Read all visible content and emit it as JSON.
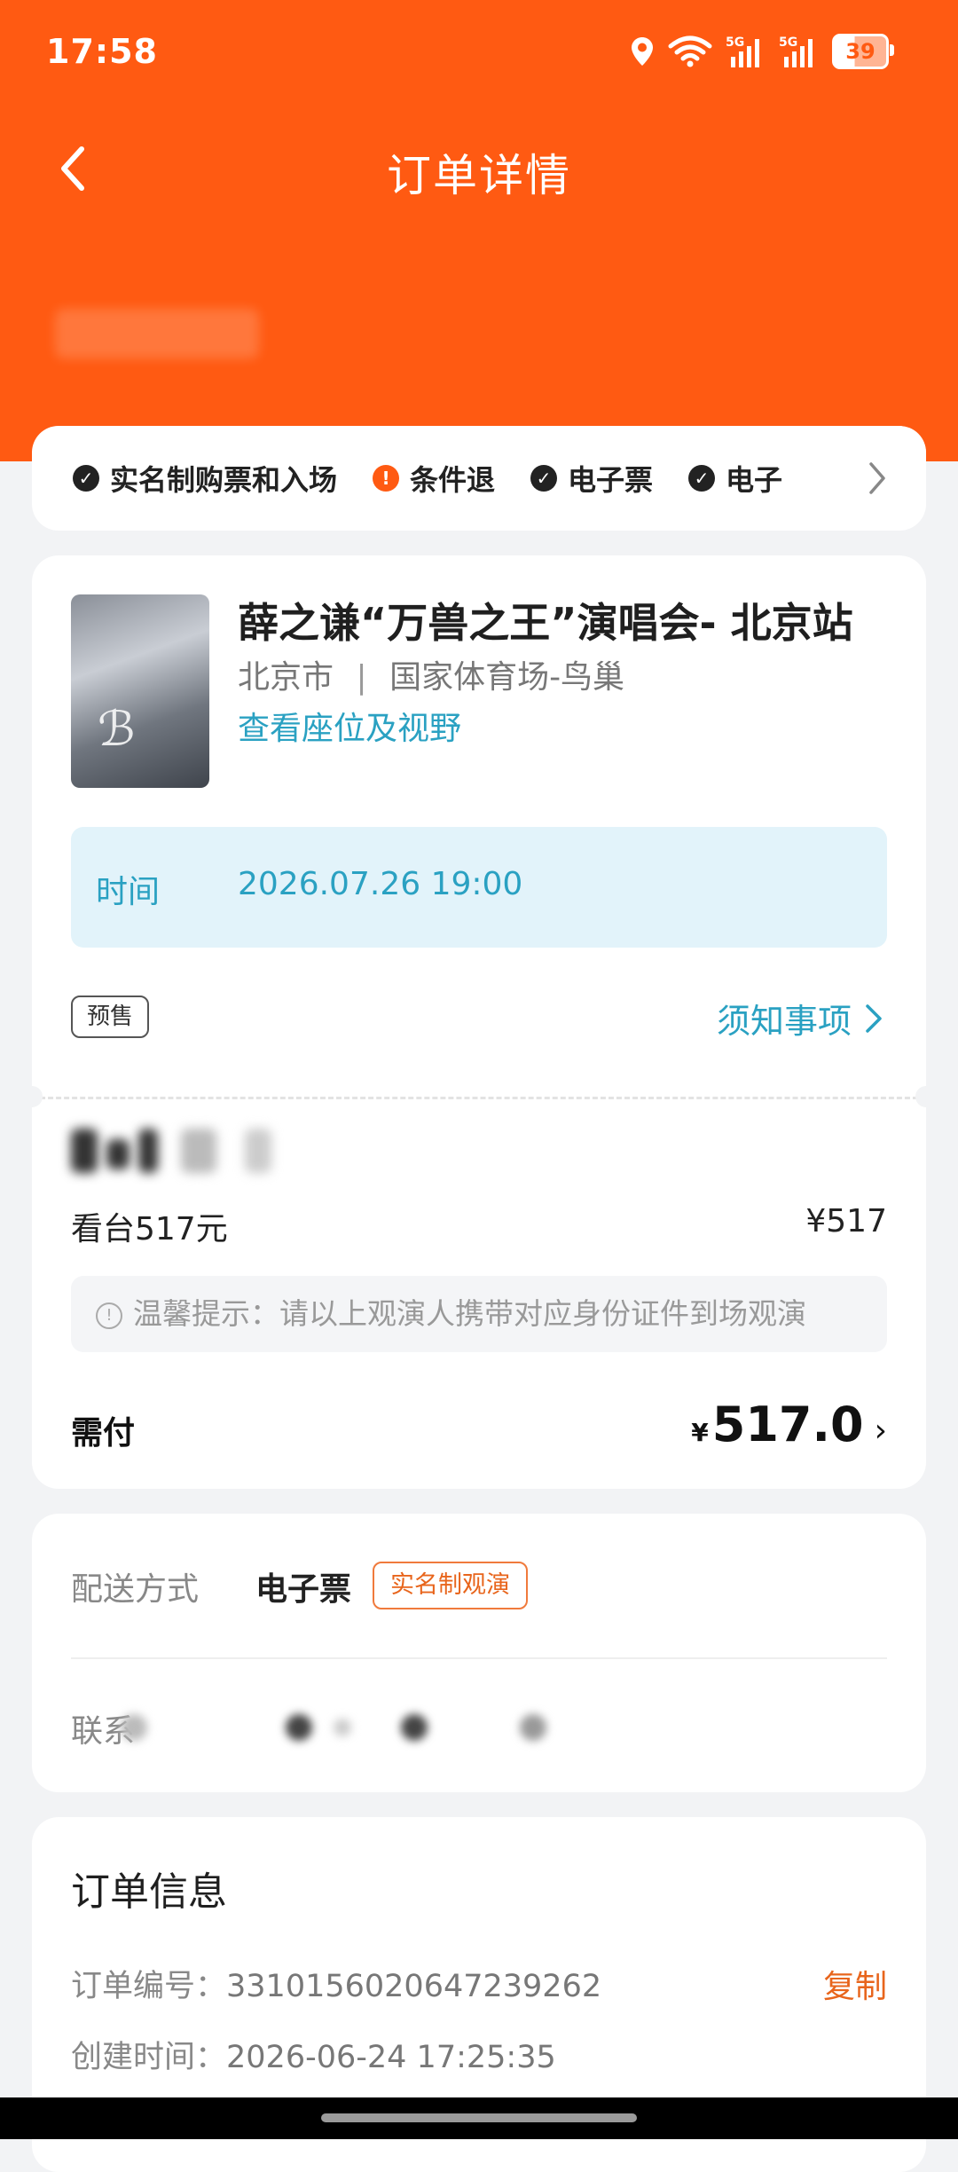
{
  "status_bar": {
    "time": "17:58",
    "battery": "39"
  },
  "header": {
    "title": "订单详情"
  },
  "features": [
    {
      "label": "实名制购票和入场",
      "icon": "check-circle-icon",
      "color": "#222222"
    },
    {
      "label": "条件退",
      "icon": "exclamation-circle-icon",
      "color": "#ff5a12"
    },
    {
      "label": "电子票",
      "icon": "check-circle-icon",
      "color": "#222222"
    },
    {
      "label": "电子",
      "icon": "check-circle-icon",
      "color": "#222222"
    }
  ],
  "event": {
    "title": "薛之谦“万兽之王”演唱会- 北京站",
    "city": "北京市",
    "venue": "国家体育场-鸟巢",
    "seat_link": "查看座位及视野",
    "time_label": "时间",
    "time_value": "2026.07.26 19:00",
    "presale_badge": "预售",
    "notice_link": "须知事项"
  },
  "ticket": {
    "name": "看台517元",
    "price": "¥517",
    "tip": "温馨提示：请以上观演人携带对应身份证件到场观演"
  },
  "payment": {
    "label": "需付",
    "currency": "¥",
    "amount": "517.0"
  },
  "delivery": {
    "label": "配送方式",
    "value": "电子票",
    "badge": "实名制观演",
    "contact_label": "联系"
  },
  "order_info": {
    "title": "订单信息",
    "number_label": "订单编号：",
    "number_value": "3310156020647239262",
    "copy_label": "复制",
    "created_label": "创建时间：",
    "created_value": "2026-06-24 17:25:35"
  },
  "colors": {
    "brand_orange": "#ff5a12",
    "link_blue": "#2aa1c2",
    "accent_orange": "#e8651c"
  }
}
